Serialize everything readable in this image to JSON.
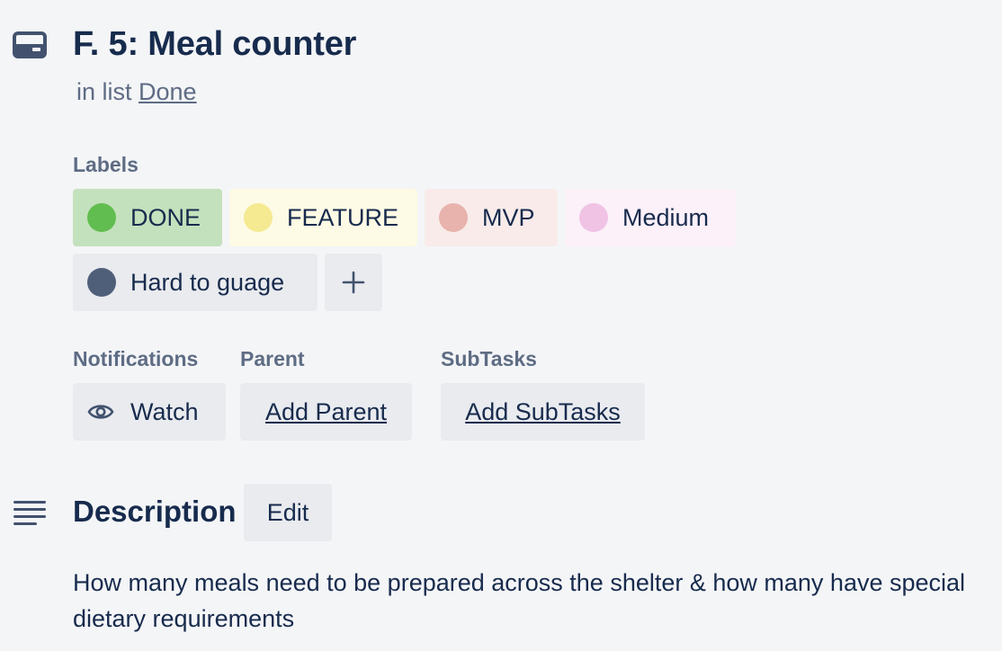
{
  "card": {
    "title": "F. 5: Meal counter",
    "in_list_prefix": "in list",
    "list_name": "Done"
  },
  "labels_section": {
    "heading": "Labels",
    "items": [
      {
        "name": "DONE",
        "dot_color": "#61bd4f",
        "bg_color": "#c4e1bd"
      },
      {
        "name": "FEATURE",
        "dot_color": "#f5ea92",
        "bg_color": "#fdfae5"
      },
      {
        "name": "MVP",
        "dot_color": "#e8b3ad",
        "bg_color": "#f8ebea"
      },
      {
        "name": "Medium",
        "dot_color": "#f0c2e4",
        "bg_color": "#fcf0f9"
      },
      {
        "name": "Hard to guage",
        "dot_color": "#505f79",
        "bg_color": "#e9ebef"
      }
    ],
    "add_icon": "plus-icon"
  },
  "notifications": {
    "heading": "Notifications",
    "watch_label": "Watch",
    "watch_icon": "eye-icon"
  },
  "parent": {
    "heading": "Parent",
    "button_label": "Add Parent"
  },
  "subtasks": {
    "heading": "SubTasks",
    "button_label": "Add SubTasks"
  },
  "description": {
    "heading": "Description",
    "edit_label": "Edit",
    "icon": "description-lines-icon",
    "text": "How many meals need to be prepared across the shelter & how many have special dietary requirements"
  },
  "header_icon": "card-icon"
}
